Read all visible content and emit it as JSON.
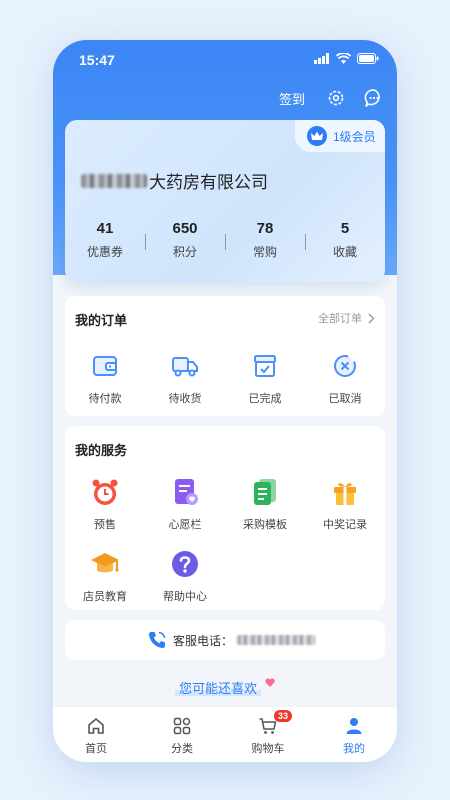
{
  "status_bar": {
    "time": "15:47"
  },
  "header": {
    "checkin_label": "签到"
  },
  "member": {
    "level_badge": "1级会员",
    "company_name": "大药房有限公司",
    "stats": [
      {
        "value": "41",
        "label": "优惠券"
      },
      {
        "value": "650",
        "label": "积分"
      },
      {
        "value": "78",
        "label": "常购"
      },
      {
        "value": "5",
        "label": "收藏"
      }
    ]
  },
  "orders": {
    "title": "我的订单",
    "all_link": "全部订单",
    "items": [
      {
        "label": "待付款",
        "icon": "wallet-icon"
      },
      {
        "label": "待收货",
        "icon": "truck-icon"
      },
      {
        "label": "已完成",
        "icon": "box-check-icon"
      },
      {
        "label": "已取消",
        "icon": "cancel-clock-icon"
      }
    ]
  },
  "services": {
    "title": "我的服务",
    "items": [
      {
        "label": "预售",
        "icon": "alarm-clock-icon"
      },
      {
        "label": "心愿栏",
        "icon": "wishlist-icon"
      },
      {
        "label": "采购模板",
        "icon": "template-icon"
      },
      {
        "label": "中奖记录",
        "icon": "gift-icon"
      },
      {
        "label": "店员教育",
        "icon": "graduation-cap-icon"
      },
      {
        "label": "帮助中心",
        "icon": "help-icon"
      }
    ]
  },
  "hotline": {
    "label": "客服电话："
  },
  "recommend": {
    "title": "您可能还喜欢"
  },
  "tabbar": {
    "items": [
      {
        "label": "首页",
        "icon": "home-icon"
      },
      {
        "label": "分类",
        "icon": "category-icon"
      },
      {
        "label": "购物车",
        "icon": "cart-icon",
        "badge": "33"
      },
      {
        "label": "我的",
        "icon": "user-icon"
      }
    ],
    "active_index": 3
  },
  "colors": {
    "accent": "#2f7cf6",
    "header_blue": "#3b86f5",
    "badge_red": "#f0352b"
  }
}
